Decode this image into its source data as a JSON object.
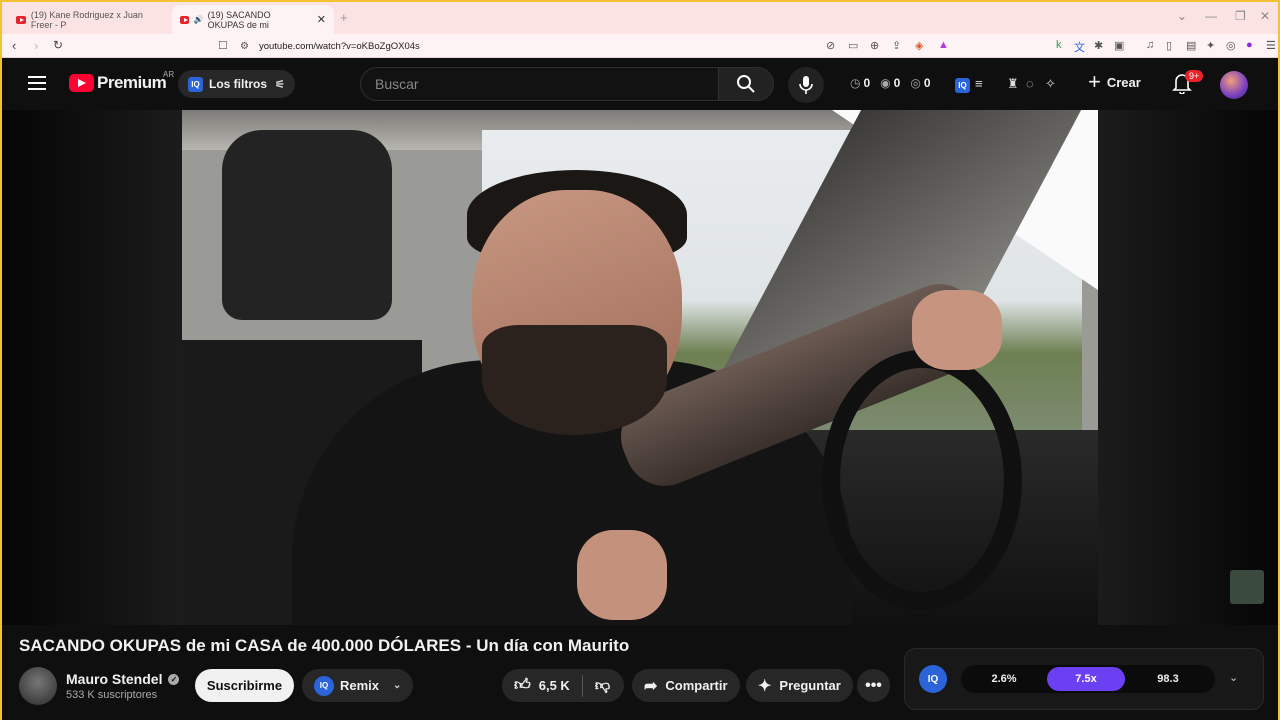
{
  "browser": {
    "tabs": [
      {
        "title": "(19) Kane Rodriguez x Juan Freer - P"
      },
      {
        "title": "(19) SACANDO OKUPAS de mi"
      }
    ],
    "new_tab": "+",
    "url": "youtube.com/watch?v=oKBoZgOX04s"
  },
  "header": {
    "logo_text": "Premium",
    "country": "AR",
    "filters_label": "Los filtros",
    "iq_label": "IQ",
    "search_placeholder": "Buscar",
    "stats": [
      "0",
      "0",
      "0"
    ],
    "create_label": "Crear",
    "notif_badge": "9+"
  },
  "video": {
    "title": "SACANDO OKUPAS de mi CASA de 400.000 DÓLARES - Un día con Maurito"
  },
  "channel": {
    "name": "Mauro Stendel",
    "subscribers": "533 K suscriptores",
    "subscribe_label": "Suscribirme"
  },
  "actions": {
    "remix_label": "Remix",
    "likes": "6,5 K",
    "share_label": "Compartir",
    "ask_label": "Preguntar"
  },
  "iq_panel": {
    "metrics": [
      "2.6%",
      "7.5x",
      "98.3"
    ]
  }
}
